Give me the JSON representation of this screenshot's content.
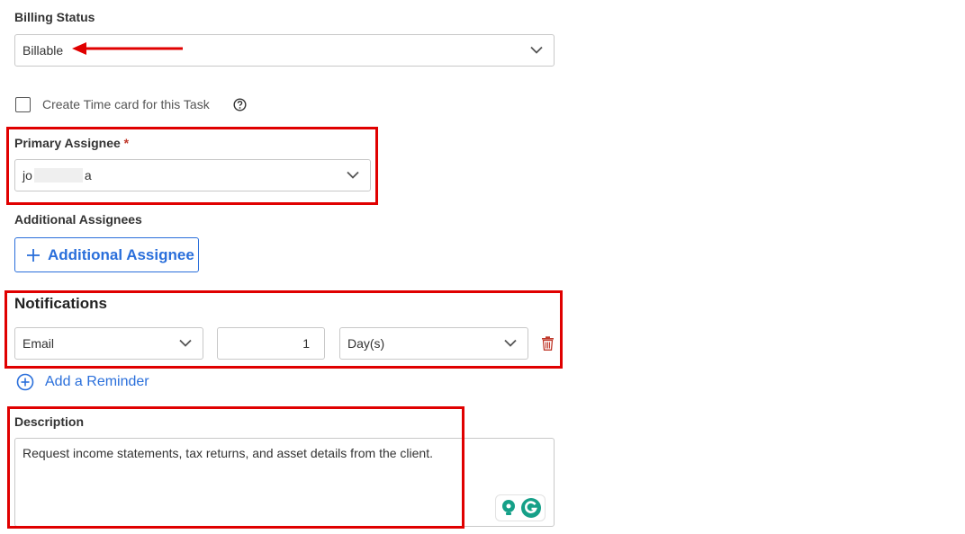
{
  "billing": {
    "label": "Billing Status",
    "value": "Billable"
  },
  "timecard": {
    "label": "Create Time card for this Task",
    "checked": false
  },
  "primary_assignee": {
    "label": "Primary Assignee",
    "required_mark": "*",
    "value_prefix": "jo",
    "value_suffix": "a"
  },
  "additional_assignees": {
    "label": "Additional Assignees",
    "button_label": "Additional Assignee"
  },
  "notifications": {
    "label": "Notifications",
    "method": "Email",
    "amount": "1",
    "unit": "Day(s)",
    "add_reminder_label": "Add a Reminder"
  },
  "description": {
    "label": "Description",
    "text": "Request income statements, tax returns, and asset details from the client."
  },
  "colors": {
    "accent": "#2a6fdb",
    "annotation_red": "#e00000",
    "delete_red": "#c0392b",
    "grammarly_green": "#15a088"
  }
}
